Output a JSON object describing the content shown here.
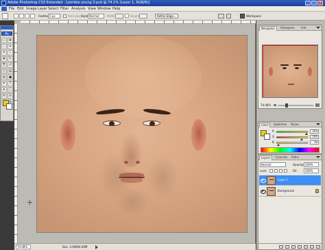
{
  "window": {
    "title": "Adobe Photoshop CS3 Extended - [zombie young 3.psd @ 74.1% (Layer 1, RGB/8)]",
    "minimize": "_",
    "maximize": "□",
    "close": "x"
  },
  "menu": [
    "File",
    "Edit",
    "Image",
    "Layer",
    "Select",
    "Filter",
    "Analysis",
    "View",
    "Window",
    "Help"
  ],
  "options": {
    "feather_label": "Feather:",
    "feather_value": "0 px",
    "antialias_label": "Anti-alias",
    "style_label": "Style:",
    "style_value": "Normal",
    "width_label": "Width:",
    "height_label": "Height:",
    "refine_edge": "Refine Edge...",
    "workspace": "Workspace"
  },
  "toolbox": {
    "header": "Ps",
    "tools": [
      "marquee-tool",
      "move-tool",
      "lasso-tool",
      "magic-wand-tool",
      "crop-tool",
      "slice-tool",
      "healing-brush-tool",
      "brush-tool",
      "clone-stamp-tool",
      "history-brush-tool",
      "eraser-tool",
      "gradient-tool",
      "blur-tool",
      "dodge-tool",
      "pen-tool",
      "type-tool",
      "path-selection-tool",
      "shape-tool",
      "notes-tool",
      "eyedropper-tool",
      "hand-tool",
      "zoom-tool"
    ],
    "foreground_color": "#f4cf10",
    "background_color": "#ffffff"
  },
  "status": {
    "zoom": "74.08%",
    "doc": "Doc: 3.00M/6.00M"
  },
  "navigator": {
    "tabs": [
      "Navigator",
      "Histogram",
      "Info"
    ],
    "zoom": "74.08%",
    "zoom_fraction": 0.25
  },
  "color_panel": {
    "tabs": [
      "Color",
      "Swatches",
      "Styles"
    ],
    "channels": [
      {
        "name": "R",
        "value": "244",
        "fraction": 0.96,
        "gradient": "linear-gradient(90deg,#00cf10,#ffcf10)"
      },
      {
        "name": "G",
        "value": "206",
        "fraction": 0.81,
        "gradient": "linear-gradient(90deg,#f40010,#f4ff10)"
      },
      {
        "name": "B",
        "value": "16",
        "fraction": 0.06,
        "gradient": "linear-gradient(90deg,#f4ce00,#f4ceff)"
      }
    ]
  },
  "layers_panel": {
    "tabs": [
      "Layers",
      "Channels",
      "Paths"
    ],
    "blend_mode": "Normal",
    "opacity_label": "Opacity:",
    "opacity_value": "100%",
    "lock_label": "Lock:",
    "fill_label": "Fill:",
    "fill_value": "100%",
    "layers": [
      {
        "name": "Layer 1",
        "selected": true,
        "locked": false
      },
      {
        "name": "Background",
        "selected": false,
        "locked": true
      }
    ]
  },
  "colors": {
    "title_bar": "#1c3f96",
    "selected_layer": "#3d8ef5",
    "ui_panel": "#e9e7e0"
  }
}
